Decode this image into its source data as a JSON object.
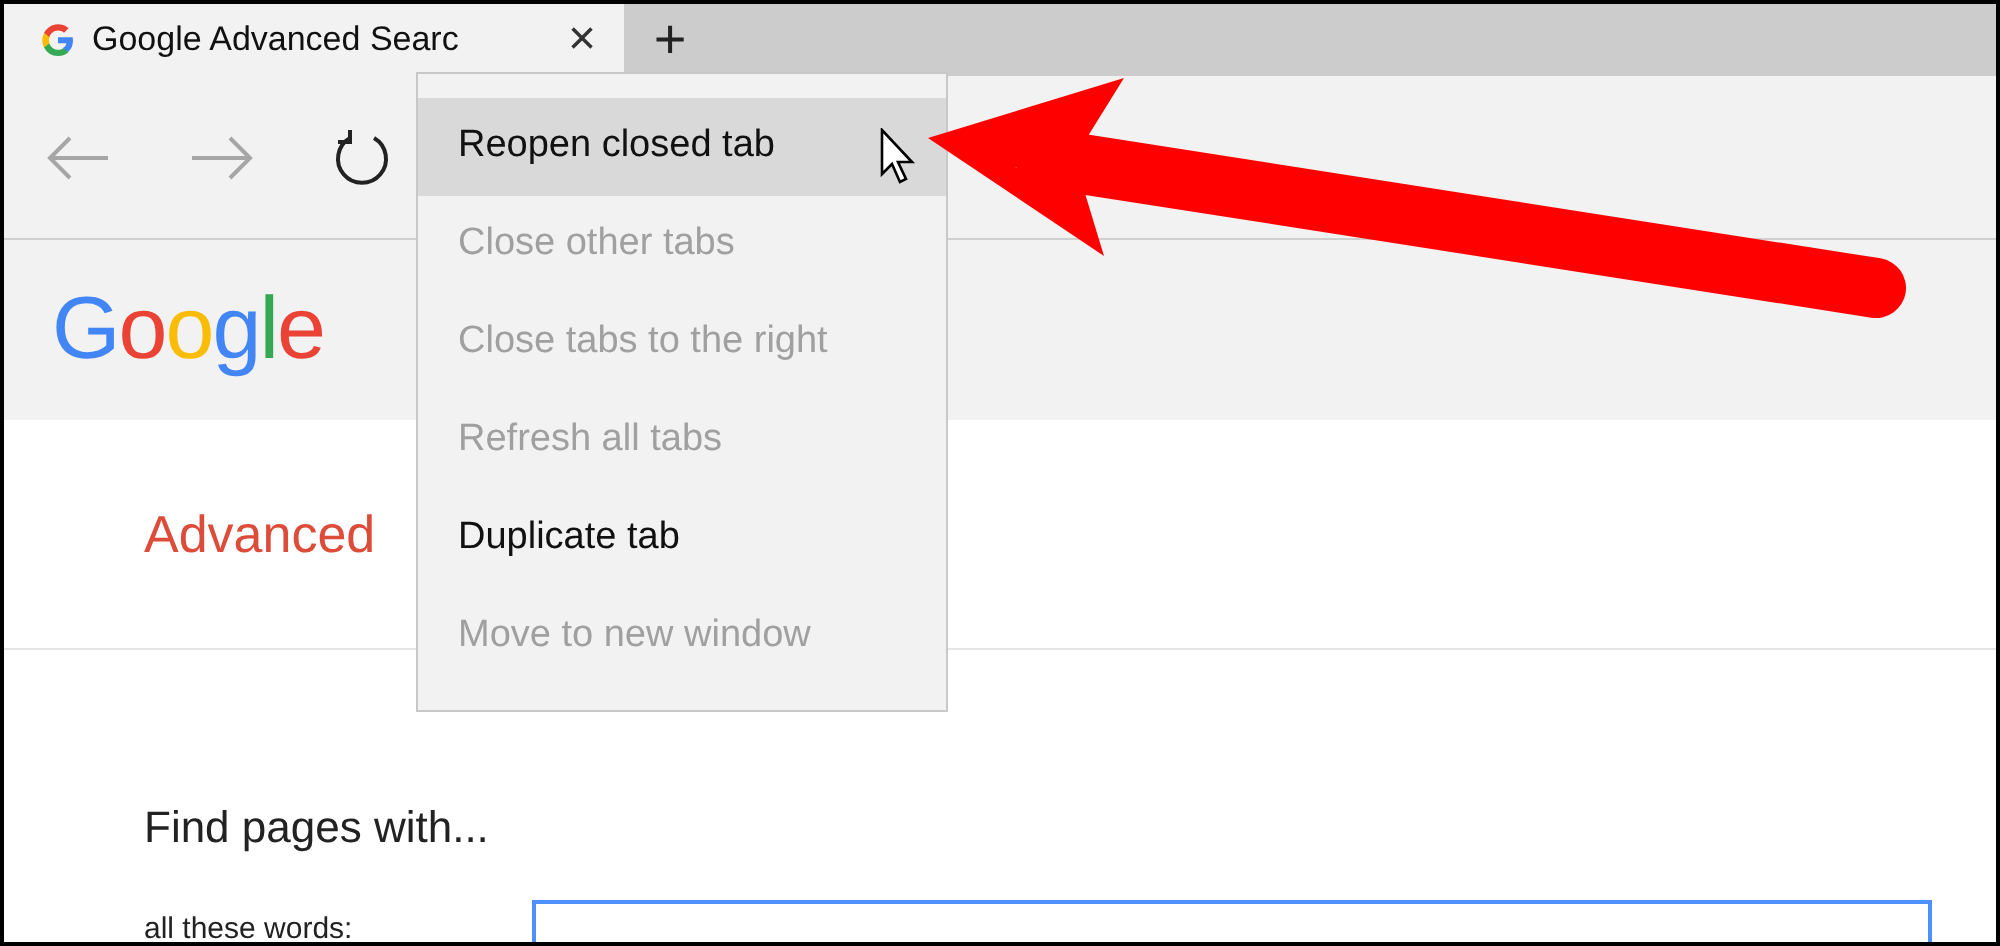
{
  "tab": {
    "title": "Google Advanced Searc",
    "close": "×",
    "selected": true
  },
  "new_tab": "+",
  "context_menu": [
    {
      "label": "Reopen closed tab",
      "disabled": false,
      "selected": true
    },
    {
      "label": "Close other tabs",
      "disabled": true,
      "selected": false
    },
    {
      "label": "Close tabs to the right",
      "disabled": true,
      "selected": false
    },
    {
      "label": "Refresh all tabs",
      "disabled": true,
      "selected": false
    },
    {
      "label": "Duplicate tab",
      "disabled": false,
      "selected": false
    },
    {
      "label": "Move to new window",
      "disabled": true,
      "selected": false
    }
  ],
  "page": {
    "logo": "Google",
    "heading": "Advanced",
    "section": "Find pages with...",
    "field_label": "all these words:"
  }
}
